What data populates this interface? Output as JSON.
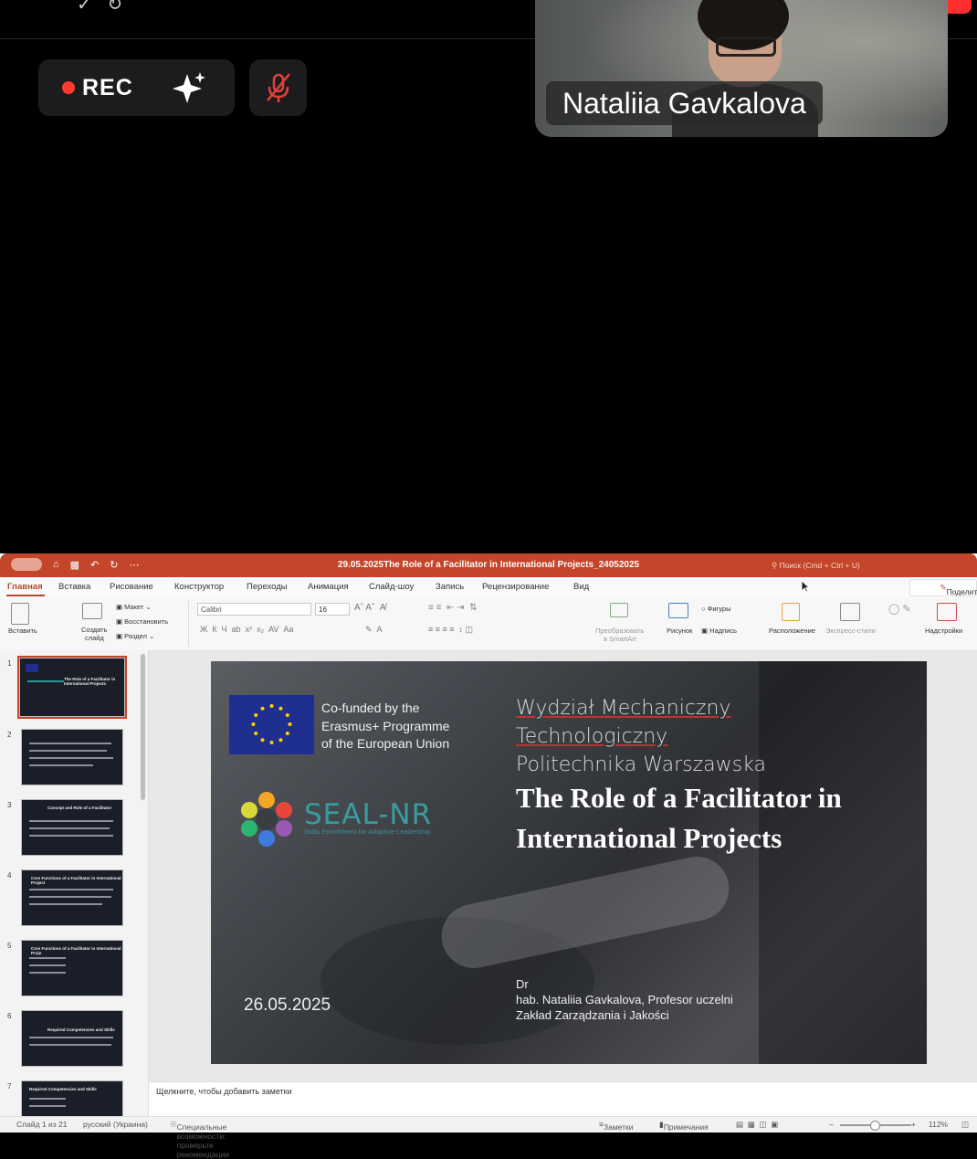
{
  "meeting": {
    "rec_label": "REC",
    "participant_name": "Nataliia Gavkalova"
  },
  "ppt": {
    "window_title": "29.05.2025The Role of a Facilitator in International Projects_24052025",
    "search_placeholder": "Поиск (Cmd + Ctrl + U)",
    "share_label": "Поделиться",
    "tabs": [
      "Главная",
      "Вставка",
      "Рисование",
      "Конструктор",
      "Переходы",
      "Анимация",
      "Слайд-шоу",
      "Запись",
      "Рецензирование",
      "Вид"
    ],
    "ribbon": {
      "paste": "Вставить",
      "new_slide_1": "Создать",
      "new_slide_2": "слайд",
      "layout": "Макет",
      "reset": "Восстановить",
      "section": "Раздел",
      "font": "Calibri",
      "font_size": "16",
      "smartart_1": "Преобразовать",
      "smartart_2": "в SmartArt",
      "picture": "Рисунок",
      "shapes": "Фигуры",
      "textbox": "Надпись",
      "arrange": "Расположение",
      "quick_styles": "Экспресс-стили",
      "addins": "Надстройки"
    },
    "thumbnails": [
      {
        "num": "1",
        "title": "The Role of a Facilitator in International Projects"
      },
      {
        "num": "2",
        "title": ""
      },
      {
        "num": "3",
        "title": "Concept and Role of a Facilitator"
      },
      {
        "num": "4",
        "title": "Core Functions of a Facilitator in International Project"
      },
      {
        "num": "5",
        "title": "Core Functions of a Facilitator in International Proje"
      },
      {
        "num": "6",
        "title": "Required Competencies and Skills"
      },
      {
        "num": "7",
        "title": "Required Competencies and Skills"
      }
    ],
    "slide": {
      "cofund_1": "Co-funded by the",
      "cofund_2": "Erasmus+ Programme",
      "cofund_3": "of the European Union",
      "seal_name": "SEAL-NR",
      "seal_sub": "Skills Enrichment for Adaptive Leadership",
      "wydzial_1": "Wydział Mechaniczny",
      "wydzial_2": "Technologiczny",
      "politechnika_1": "Politechnika",
      "politechnika_2": "Warszawska",
      "title_1": "The Role of a Facilitator in",
      "title_2": "International Projects",
      "date": "26.05.2025",
      "author_1": "Dr",
      "author_2": "hab. Nataliia Gavkalova, Profesor uczelni",
      "author_3": "Zakład Zarządzania i Jakości"
    },
    "notes_placeholder": "Щелкните, чтобы добавить заметки",
    "status": {
      "slide_counter": "Слайд 1 из 21",
      "language": "русский (Украина)",
      "accessibility": "Специальные возможности: проверьте рекомендации",
      "notes": "Заметки",
      "comments": "Примечания",
      "zoom": "112%"
    }
  }
}
